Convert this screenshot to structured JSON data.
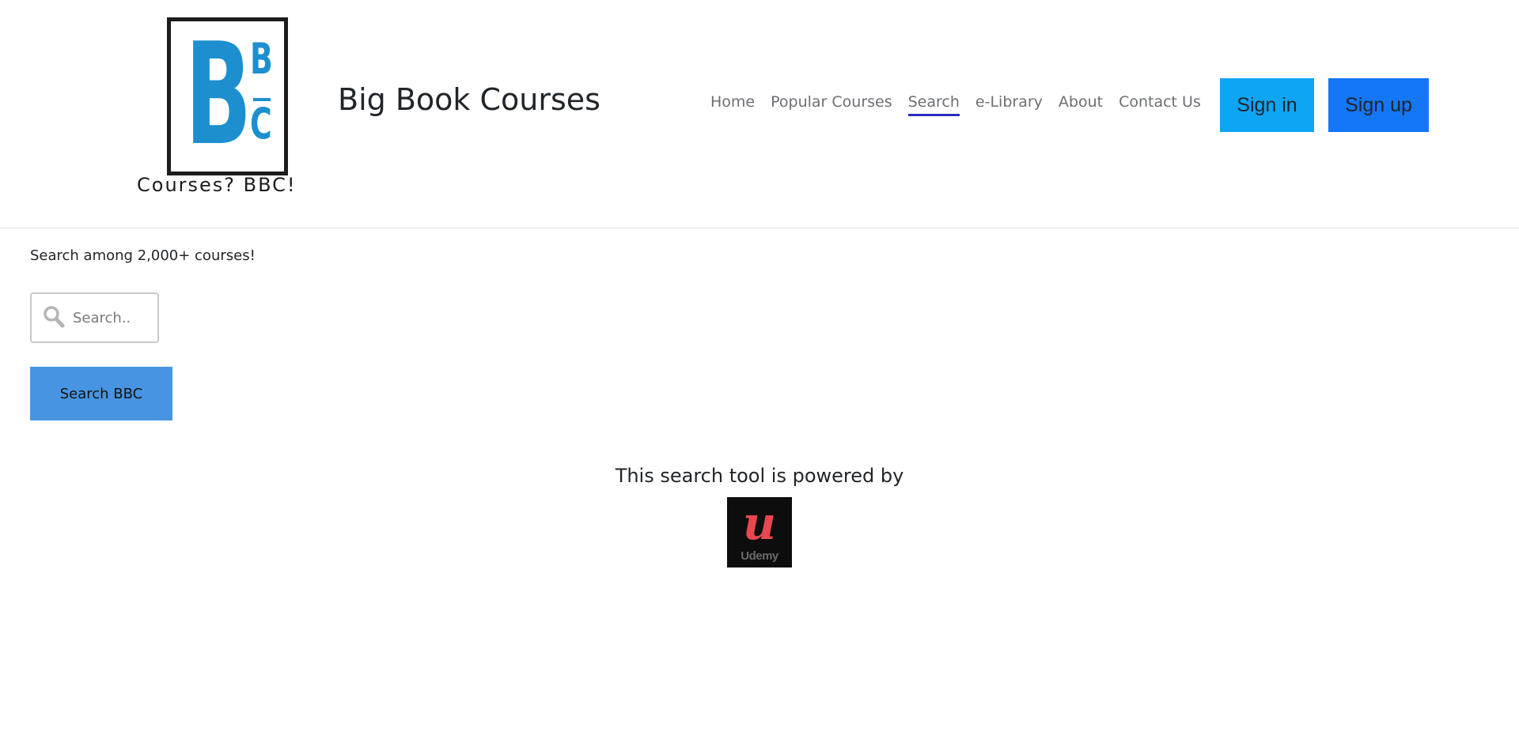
{
  "logo": {
    "big_letter": "B",
    "small_top": "B",
    "small_bottom": "C",
    "tagline": "Courses? BBC!",
    "color": "#1d8fcf"
  },
  "brand": {
    "title": "Big Book Courses"
  },
  "nav": {
    "items": [
      {
        "label": "Home"
      },
      {
        "label": "Popular Courses"
      },
      {
        "label": "Search"
      },
      {
        "label": "e-Library"
      },
      {
        "label": "About"
      },
      {
        "label": "Contact Us"
      }
    ],
    "active": "Search",
    "active_color": "#2a2dbf"
  },
  "auth": {
    "signin_label": "Sign in",
    "signup_label": "Sign up",
    "signin_color": "#0ea5f5",
    "signup_color": "#1477f8"
  },
  "search": {
    "intro": "Search among 2,000+ courses!",
    "placeholder": "Search..",
    "value": "",
    "button_label": "Search BBC",
    "button_color": "#4795e2",
    "icon": "search-icon"
  },
  "powered": {
    "text": "This search tool is powered by",
    "udemy_letter": "u",
    "udemy_word": "Udemy",
    "udemy_color": "#e8474f"
  }
}
